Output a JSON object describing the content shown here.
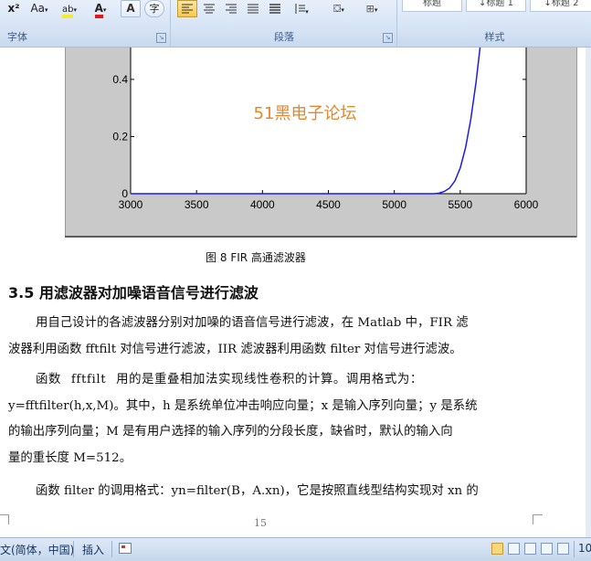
{
  "ribbon": {
    "font_group": {
      "label": "字体",
      "superscript_label": "x²",
      "change_case_label": "Aa",
      "highlight_label": "ab",
      "font_color_label": "A",
      "char_shading_label": "A",
      "enclose_char_label": "字"
    },
    "paragraph_group": {
      "label": "段落"
    },
    "styles_group": {
      "label": "样式",
      "style_items": [
        "标题",
        "↓标题 1",
        "↓标题 2"
      ]
    }
  },
  "figure": {
    "watermark": "51黑电子论坛",
    "caption": "图 8 FIR 高通滤波器",
    "chart_data": {
      "type": "line",
      "x_ticks": [
        3000,
        3500,
        4000,
        4500,
        5000,
        5500,
        6000
      ],
      "y_ticks": [
        0,
        0.2,
        0.4
      ],
      "y_tick_labels": [
        "0",
        "0.2",
        "0.4"
      ],
      "xlim": [
        3000,
        6000
      ],
      "ylim": [
        0,
        0.55
      ],
      "series": [
        {
          "color": "#1c1ce6",
          "x": [
            3000,
            5300,
            5340,
            5380,
            5420,
            5460,
            5500,
            5540,
            5580,
            5620,
            5660
          ],
          "y": [
            0,
            0,
            0.002,
            0.008,
            0.02,
            0.045,
            0.09,
            0.16,
            0.26,
            0.39,
            0.55
          ]
        }
      ],
      "grid": false,
      "legend": "none"
    }
  },
  "section": {
    "heading": "3.5 用滤波器对加噪语音信号进行滤波"
  },
  "body": {
    "p1": [
      "用自己设计的各滤波器分别对加噪的语音信号进行滤波，在 Matlab 中，FIR 滤",
      "波器利用函数 fftfilt 对信号进行滤波，IIR 滤波器利用函数 filter 对信号进行滤波。"
    ],
    "p2": [
      "函数 fftfilt 用的是重叠相加法实现线性卷积的计算。调用格式为：",
      "y=fftfilter(h,x,M)。其中，h 是系统单位冲击响应向量；x 是输入序列向量；y 是系统",
      "的输出序列向量；M 是有用户选择的输入序列的分段长度，缺省时，默认的输入向",
      "量的重长度 M=512。"
    ],
    "p3": [
      "函数 filter 的调用格式：yn=filter(B，A.xn)，它是按照直线型结构实现对 xn 的"
    ],
    "page_number": "15"
  },
  "status_bar": {
    "language": "文(简体，中国)",
    "insert_mode": "插入",
    "zoom_fragment": "10"
  },
  "colors": {
    "ribbon_label": "#3b5a86",
    "watermark": "#e8862a",
    "plot_line": "#1c1ce6"
  }
}
